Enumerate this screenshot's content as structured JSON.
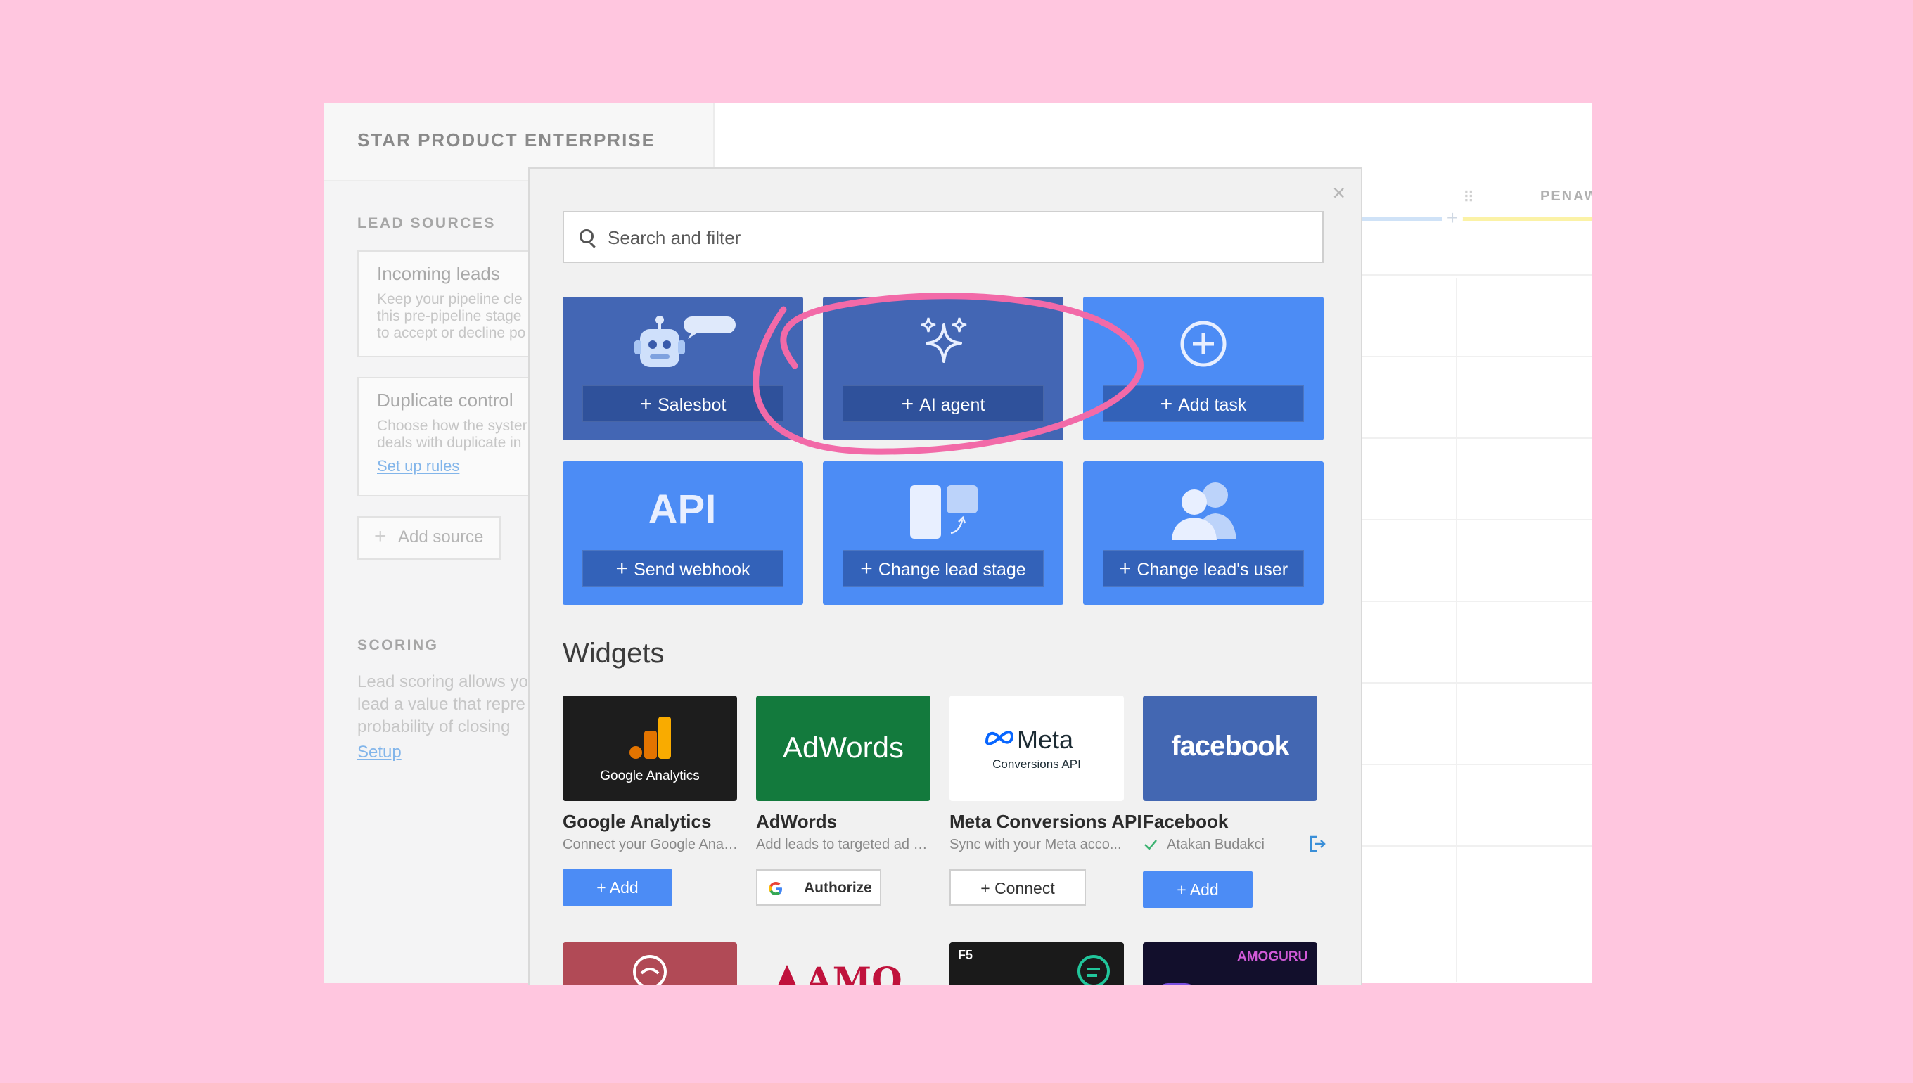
{
  "app": {
    "title": "STAR PRODUCT ENTERPRISE",
    "lead_sources_title": "LEAD SOURCES",
    "incoming": {
      "title": "Incoming leads",
      "desc": "Keep your pipeline cle\nthis pre-pipeline stage\nto accept or decline po"
    },
    "duplicate": {
      "title": "Duplicate control",
      "desc": "Choose how the syster\ndeals with duplicate in",
      "link": "Set up rules"
    },
    "add_source": "Add source",
    "scoring_title": "SCORING",
    "scoring_text": "Lead scoring allows yo\nlead a value that repre\nprobability of closing",
    "scoring_link": "Setup",
    "pipeline_stage": "PENAW"
  },
  "modal": {
    "close": "×",
    "search_placeholder": "Search and filter",
    "actions": [
      {
        "label": "Salesbot",
        "icon": "robot-icon"
      },
      {
        "label": "AI agent",
        "icon": "sparkles-icon"
      },
      {
        "label": "Add task",
        "icon": "plus-circle-icon"
      },
      {
        "label": "Send webhook",
        "icon": "api-icon"
      },
      {
        "label": "Change lead stage",
        "icon": "stage-icon"
      },
      {
        "label": "Change lead's user",
        "icon": "users-icon"
      }
    ],
    "widgets_title": "Widgets",
    "widgets": [
      {
        "name": "Google Analytics",
        "desc": "Connect your Google Anal...",
        "logo_text": "Google Analytics",
        "button": "+ Add"
      },
      {
        "name": "AdWords",
        "desc": "Add leads to targeted ad c...",
        "logo_text": "AdWords",
        "button": "Authorize"
      },
      {
        "name": "Meta Conversions API",
        "desc": "Sync with your Meta acco...",
        "logo_text": "Meta",
        "logo_sub": "Conversions API",
        "button": "+ Connect"
      },
      {
        "name": "Facebook",
        "status": "Atakan Budakci",
        "logo_text": "facebook",
        "button": "+ Add"
      }
    ],
    "more_widgets": [
      {
        "logo_text": "AMO"
      },
      {
        "logo_text": "F5"
      },
      {
        "logo_text": "AMOGURU"
      }
    ]
  },
  "colors": {
    "page_bg": "#ffc6df",
    "tile_dark": "#4366b4",
    "tile_light": "#4c8cf5",
    "annotation": "#f26aa8"
  }
}
